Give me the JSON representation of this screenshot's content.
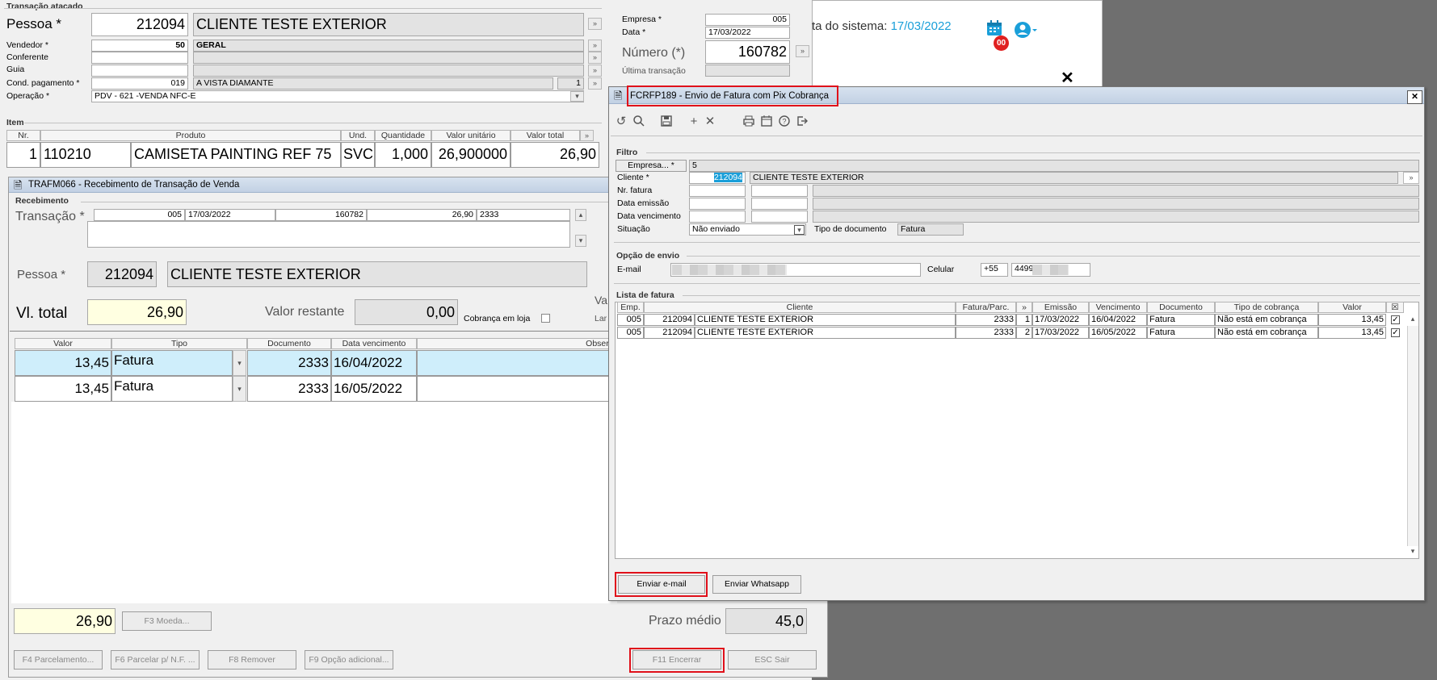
{
  "bg_app": {
    "date_label": "ta do sistema:",
    "date_value": "17/03/2022",
    "badge": "00"
  },
  "transacao": {
    "group_title": "Transação atacado",
    "pessoa_label": "Pessoa *",
    "pessoa_code": "212094",
    "pessoa_name": "CLIENTE TESTE EXTERIOR",
    "vendedor_label": "Vendedor *",
    "vendedor_code": "50",
    "vendedor_name": "GERAL",
    "conferente_label": "Conferente",
    "guia_label": "Guia",
    "cond_label": "Cond. pagamento *",
    "cond_code": "019",
    "cond_name": "A VISTA DIAMANTE",
    "cond_extra": "1",
    "operacao_label": "Operação *",
    "operacao_value": "PDV - 621 -VENDA NFC-E",
    "empresa_label": "Empresa *",
    "empresa_value": "005",
    "data_label": "Data *",
    "data_value": "17/03/2022",
    "numero_label": "Número (*)",
    "numero_value": "160782",
    "ultima_label": "Última transação"
  },
  "item": {
    "group_title": "Item",
    "headers": [
      "Nr.",
      "Produto",
      "Und.",
      "Quantidade",
      "Valor unitário",
      "Valor total"
    ],
    "row": {
      "nr": "1",
      "code": "110210",
      "produto": "CAMISETA PAINTING REF 75",
      "und": "SVC",
      "qtd": "1,000",
      "unit": "26,900000",
      "total": "26,90"
    }
  },
  "trafm": {
    "title": "TRAFM066 - Recebimento de Transação de Venda",
    "group_title": "Recebimento",
    "transacao_label": "Transação *",
    "t_empresa": "005",
    "t_data": "17/03/2022",
    "t_numero": "160782",
    "t_valor": "26,90",
    "t_doc": "2333",
    "pessoa_label": "Pessoa *",
    "pessoa_code": "212094",
    "pessoa_name": "CLIENTE TESTE EXTERIOR",
    "vl_total_label": "Vl. total",
    "vl_total": "26,90",
    "restante_label": "Valor restante",
    "restante": "0,00",
    "cobranca_label": "Cobrança em loja",
    "cut_label1": "Va",
    "cut_label2": "Lar",
    "grid_headers": [
      "Valor",
      "Tipo",
      "Documento",
      "Data vencimento",
      "Observ"
    ],
    "rows": [
      {
        "valor": "13,45",
        "tipo": "Fatura",
        "doc": "2333",
        "venc": "16/04/2022"
      },
      {
        "valor": "13,45",
        "tipo": "Fatura",
        "doc": "2333",
        "venc": "16/05/2022"
      }
    ],
    "footer_total": "26,90",
    "f3_label": "F3 Moeda...",
    "prazo_label": "Prazo médio",
    "prazo_value": "45,0",
    "buttons": [
      "F4 Parcelamento...",
      "F6 Parcelar p/ N.F. ...",
      "F8 Remover",
      "F9 Opção adicional...",
      "F11 Encerrar",
      "ESC Sair"
    ]
  },
  "fcrfp": {
    "title": "FCRFP189 - Envio de Fatura com Pix Cobrança",
    "close": "✕",
    "filtro_title": "Filtro",
    "empresa_btn": "Empresa... *",
    "empresa_value": "5",
    "cliente_label": "Cliente *",
    "cliente_code": "212094",
    "cliente_name": "CLIENTE TESTE EXTERIOR",
    "nr_fatura_label": "Nr. fatura",
    "data_emissao_label": "Data emissão",
    "data_venc_label": "Data vencimento",
    "situacao_label": "Situação",
    "situacao_value": "Não enviado",
    "tipo_doc_label": "Tipo de documento",
    "tipo_doc_value": "Fatura",
    "opcao_title": "Opção de envio",
    "email_label": "E-mail",
    "celular_label": "Celular",
    "ddi": "+55",
    "celular_value": "4499",
    "lista_title": "Lista de fatura",
    "list_headers": [
      "Emp.",
      "Cliente",
      "Fatura/Parc.",
      "»",
      "Emissão",
      "Vencimento",
      "Documento",
      "Tipo de cobrança",
      "Valor",
      "☒"
    ],
    "rows": [
      {
        "emp": "005",
        "code": "212094",
        "cliente": "CLIENTE TESTE EXTERIOR",
        "fatura": "2333",
        "parc": "1",
        "emissao": "17/03/2022",
        "venc": "16/04/2022",
        "doc": "Fatura",
        "tipo": "Não está em cobrança",
        "valor": "13,45",
        "chk": "✓"
      },
      {
        "emp": "005",
        "code": "212094",
        "cliente": "CLIENTE TESTE EXTERIOR",
        "fatura": "2333",
        "parc": "2",
        "emissao": "17/03/2022",
        "venc": "16/05/2022",
        "doc": "Fatura",
        "tipo": "Não está em cobrança",
        "valor": "13,45",
        "chk": "✓"
      }
    ],
    "btn_email": "Enviar e-mail",
    "btn_whatsapp": "Enviar Whatsapp"
  },
  "colors": {
    "accent": "#1a9fd9",
    "highlight": "#cfeefb",
    "yellow": "#ffffe1",
    "red_box": "#e0101a",
    "badge": "#e02020"
  }
}
